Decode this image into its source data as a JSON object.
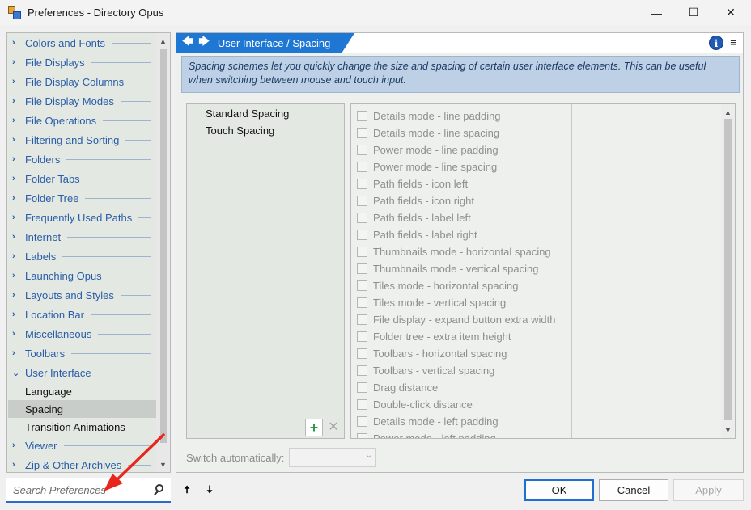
{
  "window": {
    "title": "Preferences - Directory Opus",
    "minimize": "—",
    "maximize": "☐",
    "close": "✕"
  },
  "nav": {
    "chevron_collapsed": "›",
    "chevron_expanded": "⌄",
    "items": [
      {
        "label": "Colors and Fonts"
      },
      {
        "label": "File Displays"
      },
      {
        "label": "File Display Columns"
      },
      {
        "label": "File Display Modes"
      },
      {
        "label": "File Operations"
      },
      {
        "label": "Filtering and Sorting"
      },
      {
        "label": "Folders"
      },
      {
        "label": "Folder Tabs"
      },
      {
        "label": "Folder Tree"
      },
      {
        "label": "Frequently Used Paths"
      },
      {
        "label": "Internet"
      },
      {
        "label": "Labels"
      },
      {
        "label": "Launching Opus"
      },
      {
        "label": "Layouts and Styles"
      },
      {
        "label": "Location Bar"
      },
      {
        "label": "Miscellaneous"
      },
      {
        "label": "Toolbars"
      },
      {
        "label": "User Interface"
      },
      {
        "label": "Viewer"
      },
      {
        "label": "Zip & Other Archives"
      }
    ],
    "sub_items": [
      {
        "label": "Language"
      },
      {
        "label": "Spacing"
      },
      {
        "label": "Transition Animations"
      }
    ]
  },
  "search": {
    "placeholder": "Search Preferences"
  },
  "move_up": "🠅",
  "move_down": "🠇",
  "breadcrumb": {
    "back": "🡄",
    "forward": "🡆",
    "text": "User Interface / Spacing"
  },
  "info_label": "i",
  "menu_label": "≡",
  "description": "Spacing schemes let you quickly change the size and spacing of certain user interface elements. This can be useful when switching between mouse and touch input.",
  "schemes": [
    {
      "label": "Standard Spacing"
    },
    {
      "label": "Touch Spacing"
    }
  ],
  "scheme_add": "+",
  "scheme_delete": "✕",
  "settings": [
    {
      "label": "Details mode - line padding"
    },
    {
      "label": "Details mode - line spacing"
    },
    {
      "label": "Power mode - line padding"
    },
    {
      "label": "Power mode - line spacing"
    },
    {
      "label": "Path fields - icon left"
    },
    {
      "label": "Path fields - icon right"
    },
    {
      "label": "Path fields - label left"
    },
    {
      "label": "Path fields - label right"
    },
    {
      "label": "Thumbnails mode - horizontal spacing"
    },
    {
      "label": "Thumbnails mode - vertical spacing"
    },
    {
      "label": "Tiles mode - horizontal spacing"
    },
    {
      "label": "Tiles mode - vertical spacing"
    },
    {
      "label": "File display - expand button extra width"
    },
    {
      "label": "Folder tree - extra item height"
    },
    {
      "label": "Toolbars - horizontal spacing"
    },
    {
      "label": "Toolbars - vertical spacing"
    },
    {
      "label": "Drag distance"
    },
    {
      "label": "Double-click distance"
    },
    {
      "label": "Details mode - left padding"
    },
    {
      "label": "Power mode - left padding"
    }
  ],
  "scroll_up": "▲",
  "scroll_down": "▼",
  "switch_auto": {
    "label": "Switch automatically:",
    "value": "",
    "dropdown": "⌄"
  },
  "buttons": {
    "ok": "OK",
    "cancel": "Cancel",
    "apply": "Apply"
  },
  "colors": {
    "accent": "#1f77d4",
    "annotation": "#e8261c",
    "nav_text": "#2a5ca8"
  }
}
